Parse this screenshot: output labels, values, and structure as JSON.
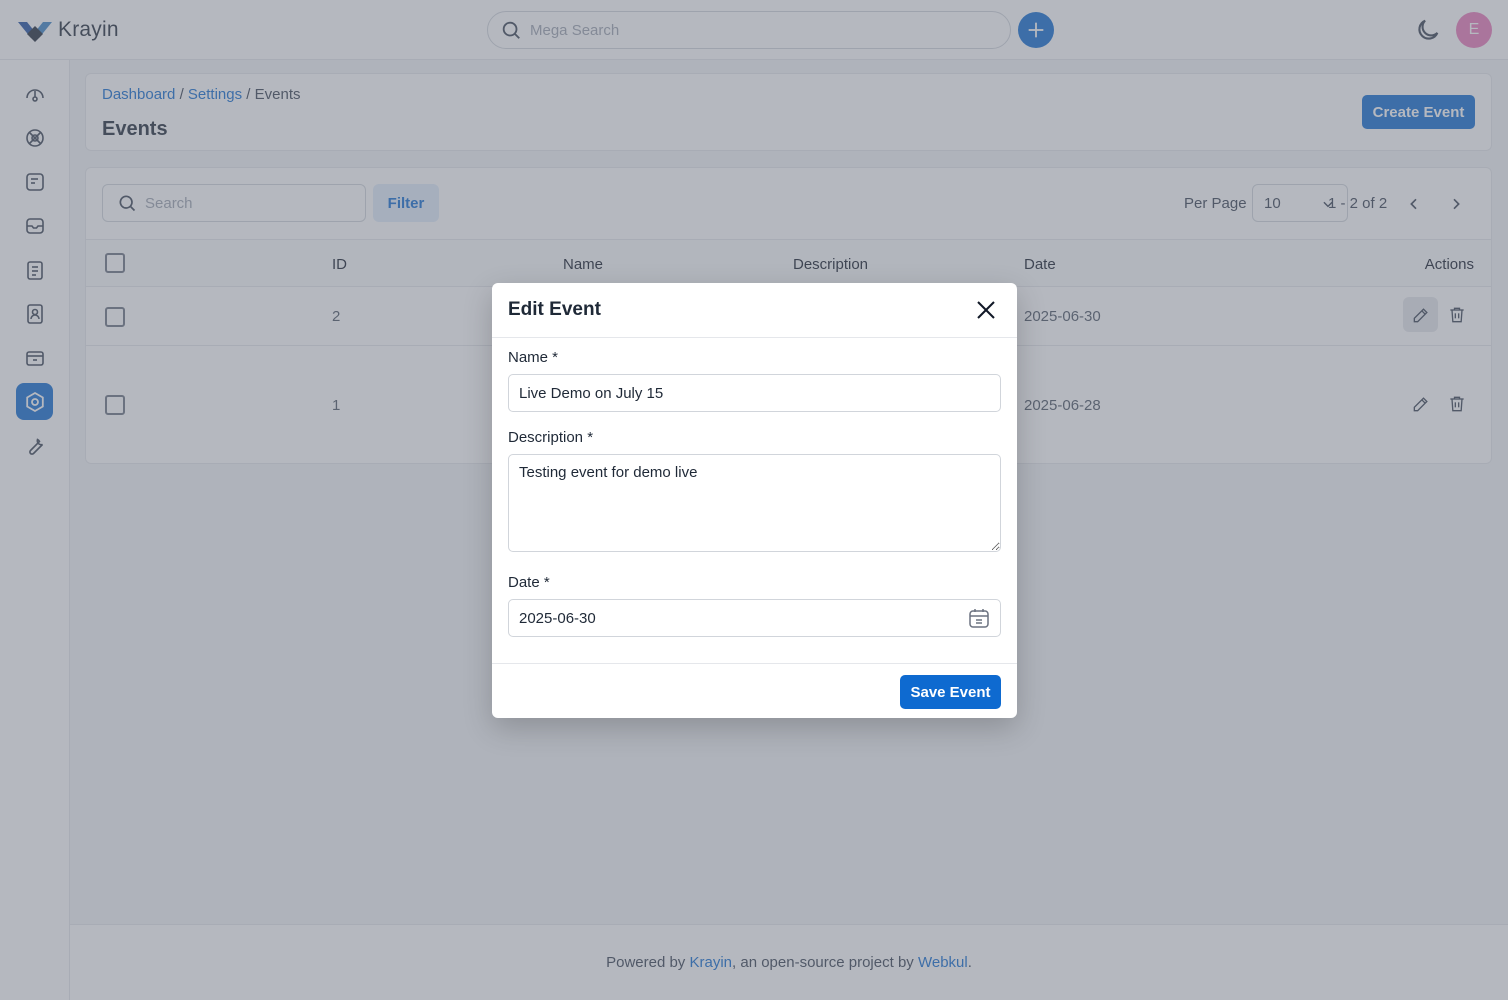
{
  "app": {
    "name": "Krayin"
  },
  "header": {
    "search_placeholder": "Mega Search",
    "avatar_initial": "E",
    "accent": "#0e6ad0"
  },
  "sidebar": {
    "items": [
      {
        "icon": "dashboard-icon",
        "active": false
      },
      {
        "icon": "leads-icon",
        "active": false
      },
      {
        "icon": "quotes-icon",
        "active": false
      },
      {
        "icon": "mail-icon",
        "active": false
      },
      {
        "icon": "activities-icon",
        "active": false
      },
      {
        "icon": "contacts-icon",
        "active": false
      },
      {
        "icon": "products-icon",
        "active": false
      },
      {
        "icon": "settings-icon",
        "active": true
      },
      {
        "icon": "configuration-icon",
        "active": false
      }
    ]
  },
  "breadcrumb": {
    "dashboard": "Dashboard",
    "settings": "Settings",
    "current": "Events",
    "sep": "/"
  },
  "page": {
    "title": "Events",
    "create_button": "Create Event"
  },
  "grid": {
    "search_placeholder": "Search",
    "filter_label": "Filter",
    "per_page_label": "Per Page",
    "per_page_value": "10",
    "pagination_info": "1 - 2 of 2",
    "columns": {
      "id": "ID",
      "name": "Name",
      "description": "Description",
      "date": "Date",
      "actions": "Actions"
    },
    "rows": [
      {
        "id": "2",
        "date": "2025-06-30"
      },
      {
        "id": "1",
        "date": "2025-06-28"
      }
    ]
  },
  "modal": {
    "title": "Edit Event",
    "name_label": "Name *",
    "name_value": "Live Demo on July 15",
    "description_label": "Description *",
    "description_value": "Testing event for demo live",
    "date_label": "Date *",
    "date_value": "2025-06-30",
    "save_button": "Save Event"
  },
  "footer": {
    "prefix": "Powered by ",
    "krayin": "Krayin",
    "middle": ", an open-source project by ",
    "webkul": "Webkul",
    "suffix": "."
  }
}
